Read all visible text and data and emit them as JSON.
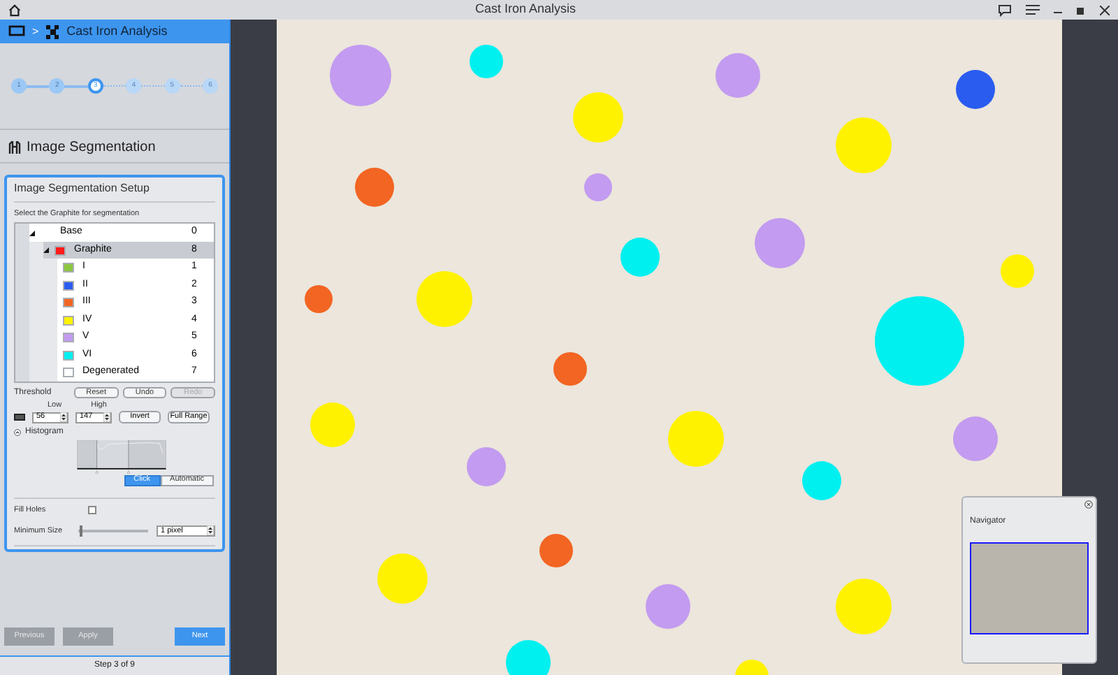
{
  "window": {
    "title": "Cast Iron Analysis"
  },
  "breadcrumb": {
    "separator": ">",
    "title": "Cast Iron Analysis"
  },
  "steps": [
    {
      "label": "1",
      "selected": false,
      "done": true
    },
    {
      "label": "2",
      "selected": false,
      "done": true
    },
    {
      "label": "3",
      "selected": true,
      "done": false
    },
    {
      "label": "4",
      "selected": false,
      "done": false
    },
    {
      "label": "5",
      "selected": false,
      "done": false
    },
    {
      "label": "6",
      "selected": false,
      "done": false
    }
  ],
  "section_title": "Image Segmentation",
  "setup": {
    "title": "Image Segmentation Setup",
    "instruction": "Select the Graphite for segmentation",
    "tree": [
      {
        "name": "Base",
        "value": "0",
        "expanded": true,
        "selected": false,
        "children": [
          {
            "name": "Graphite",
            "value": "8",
            "color": "#ff1a1a",
            "expanded": true,
            "selected": true,
            "children": [
              {
                "name": "I",
                "value": "1",
                "color": "#8cc63f",
                "selected": false
              },
              {
                "name": "II",
                "value": "2",
                "color": "#2a5cf0",
                "selected": false
              },
              {
                "name": "III",
                "value": "3",
                "color": "#f26522",
                "selected": false
              },
              {
                "name": "IV",
                "value": "4",
                "color": "#fff200",
                "selected": false
              },
              {
                "name": "V",
                "value": "5",
                "color": "#c39bf0",
                "selected": false
              },
              {
                "name": "VI",
                "value": "6",
                "color": "#00f0f0",
                "selected": false
              },
              {
                "name": "Degenerated",
                "value": "7",
                "color": "#ffffff",
                "selected": false
              }
            ]
          }
        ]
      }
    ],
    "threshold": {
      "label": "Threshold",
      "buttons": [
        {
          "label": "Reset",
          "disabled": false
        },
        {
          "label": "Undo",
          "disabled": false
        },
        {
          "label": "Redo",
          "disabled": true
        }
      ],
      "low_label": "Low",
      "high_label": "High",
      "low": "56",
      "high": "147",
      "invert": "Invert",
      "full_range": "Full Range"
    },
    "histogram": {
      "label": "Histogram",
      "expanded": true
    },
    "mode": [
      {
        "label": "Click",
        "selected": true
      },
      {
        "label": "Automatic",
        "selected": false
      }
    ],
    "fill_holes": {
      "label": "Fill Holes",
      "checked": false
    },
    "minimum_size": {
      "label": "Minimum Size",
      "level": 0.02,
      "value": "1 pixel"
    }
  },
  "nav_buttons": [
    {
      "label": "Previous",
      "kind": "secondary"
    },
    {
      "label": "Apply",
      "kind": "secondary"
    },
    {
      "label": "Next",
      "kind": "primary"
    }
  ],
  "step_status": "Step 3 of 9",
  "navigator": {
    "title": "Navigator"
  }
}
